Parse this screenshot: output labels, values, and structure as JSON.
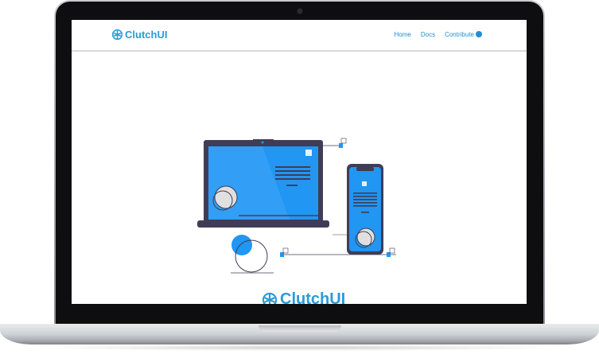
{
  "header": {
    "brand": "ClutchUI",
    "nav": [
      {
        "label": "Home"
      },
      {
        "label": "Docs"
      },
      {
        "label": "Contribute"
      }
    ]
  },
  "main": {
    "footer_brand": "ClutchUI"
  },
  "colors": {
    "accent": "#2a9bd8",
    "illustration_blue": "#2196f3",
    "device_frame": "#3f3d56"
  },
  "icons": [
    "clutch-logo-icon",
    "github-icon"
  ]
}
